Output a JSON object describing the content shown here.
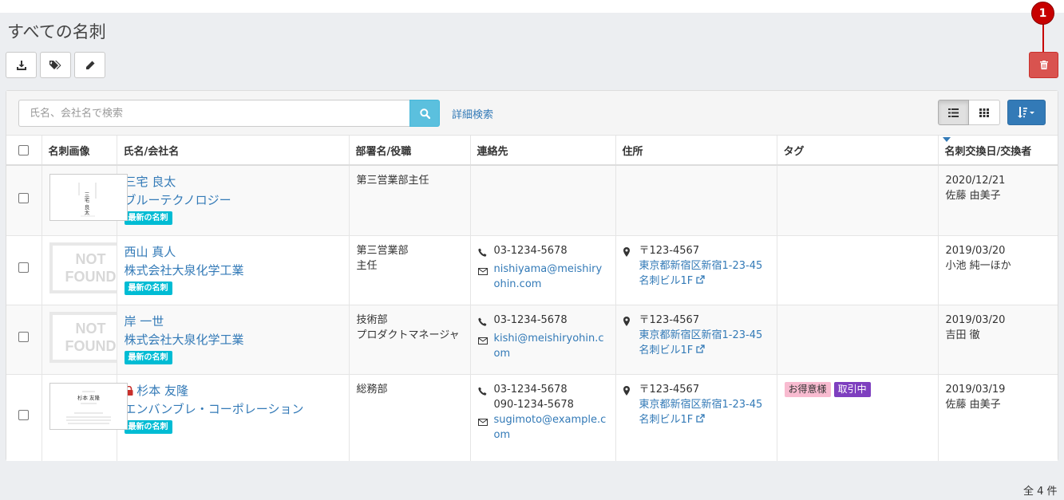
{
  "page": {
    "title": "すべての名刺",
    "total": "全 4 件"
  },
  "annotation": {
    "badge": "1"
  },
  "search": {
    "placeholder": "氏名、会社名で検索",
    "advanced_link": "詳細検索"
  },
  "table": {
    "headers": {
      "image": "名刺画像",
      "name_company": "氏名/会社名",
      "dept_title": "部署名/役職",
      "contact": "連絡先",
      "address": "住所",
      "tags": "タグ",
      "exchanged": "名刺交換日/交換者"
    },
    "rows": [
      {
        "name": "三宅 良太",
        "company": "ブルーテクノロジー",
        "new_label": "最新の名刺",
        "dept": "第三営業部主任",
        "exchange_date": "2020/12/21",
        "exchanger": "佐藤 由美子",
        "card_text": "三宅 良太"
      },
      {
        "name": "西山 真人",
        "company": "株式会社大泉化学工業",
        "new_label": "最新の名刺",
        "dept": "第三営業部",
        "title": "主任",
        "phone": "03-1234-5678",
        "email": "nishiyama@meishiryohin.com",
        "postal": "〒123-4567",
        "address": "東京都新宿区新宿1-23-45 名刺ビル1F",
        "exchange_date": "2019/03/20",
        "exchanger": "小池 純一ほか",
        "not_found": "NOT FOUND"
      },
      {
        "name": "岸 一世",
        "company": "株式会社大泉化学工業",
        "new_label": "最新の名刺",
        "dept": "技術部",
        "title": "プロダクトマネージャ",
        "phone": "03-1234-5678",
        "email": "kishi@meishiryohin.com",
        "postal": "〒123-4567",
        "address": "東京都新宿区新宿1-23-45 名刺ビル1F",
        "exchange_date": "2019/03/20",
        "exchanger": "吉田 徹",
        "not_found": "NOT FOUND"
      },
      {
        "name": "杉本 友隆",
        "company": "エンバンブレ・コーポレーション",
        "new_label": "最新の名刺",
        "dept": "総務部",
        "phone": "03-1234-5678",
        "mobile": "090-1234-5678",
        "email": "sugimoto@example.com",
        "postal": "〒123-4567",
        "address": "東京都新宿区新宿1-23-45 名刺ビル1F",
        "tags": [
          "お得意様",
          "取引中"
        ],
        "exchange_date": "2019/03/19",
        "exchanger": "佐藤 由美子",
        "card_text": "杉本 友隆"
      }
    ]
  },
  "icons": [
    "download-icon",
    "tags-icon",
    "pencil-icon",
    "trash-icon",
    "search-icon",
    "list-view-icon",
    "grid-view-icon",
    "sort-icon",
    "phone-icon",
    "envelope-icon",
    "map-marker-icon",
    "external-link-icon",
    "lock-icon"
  ],
  "colors": {
    "danger": "#d9534f",
    "info": "#5bc0de",
    "primary": "#337ab7",
    "new_label": "#00bcd4",
    "tag_pink": "#f8bbd0",
    "tag_purple": "#7e3fbf"
  }
}
